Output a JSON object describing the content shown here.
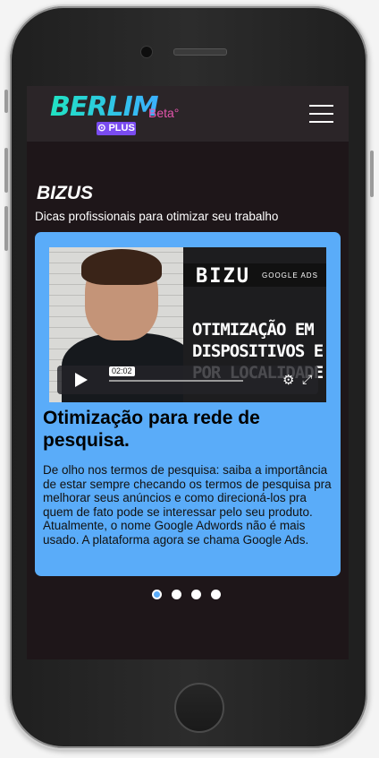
{
  "nav": {
    "logo_text": "BERLIM",
    "logo_badge": "⊙ PLUS",
    "beta_label": "Beta°",
    "menu_icon": "hamburger-menu-icon"
  },
  "section": {
    "title": "BIZUS",
    "subtitle": "Dicas profissionais para otimizar seu trabalho"
  },
  "card": {
    "video": {
      "brand_text": "BIZU",
      "brand_sub": "GOOGLE ADS",
      "overlay_text": "OTIMIZAÇÃO EM DISPOSITIVOS E POR LOCALIDADE",
      "time": "02:02"
    },
    "title": "Otimização para rede de pesquisa.",
    "body": "De olho nos termos de pesquisa: saiba a importância de estar sempre checando os termos de pesquisa pra melhorar seus anúncios e como direcioná-los pra quem de fato pode se interessar pelo seu produto. Atualmente, o nome Google Adwords não é mais usado. A plataforma agora se chama Google Ads."
  },
  "carousel": {
    "count": 4,
    "active_index": 0
  },
  "colors": {
    "accent": "#5aacf9",
    "beta": "#e455ad",
    "background": "#1e1619",
    "nav": "#2b2528"
  }
}
